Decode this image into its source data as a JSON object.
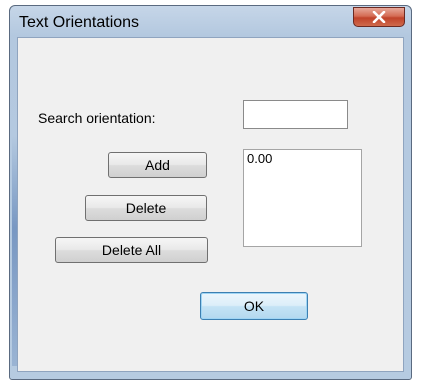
{
  "window": {
    "title": "Text Orientations"
  },
  "form": {
    "search_label": "Search orientation:",
    "search_value": "",
    "orientations": [
      "0.00"
    ]
  },
  "buttons": {
    "add": "Add",
    "delete": "Delete",
    "delete_all": "Delete All",
    "ok": "OK"
  }
}
